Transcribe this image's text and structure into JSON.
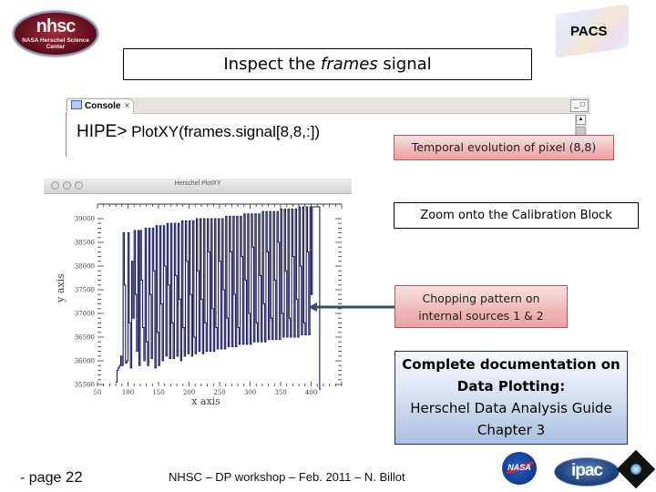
{
  "logos": {
    "nhsc": {
      "main": "nhsc",
      "sub": "NASA Herschel Science Center"
    },
    "pacs": {
      "label": "PACS"
    },
    "nasa": {
      "label": "NASA"
    },
    "ipac": {
      "label": "ipac"
    },
    "herschel": {
      "label": "Herschel"
    }
  },
  "title": {
    "before": "Inspect the ",
    "italic": "frames",
    "after": " signal"
  },
  "console": {
    "tab_label": "Console",
    "tab_close": "×",
    "prompt": "HIPE>",
    "command": " PlotXY(frames.signal[8,8,:])",
    "window_controls": "_ □",
    "scroll_up": "▲"
  },
  "callouts": {
    "temporal": "Temporal evolution of pixel (8,8)",
    "zoom": "Zoom onto the Calibration Block",
    "chopping_line1": "Chopping pattern on",
    "chopping_line2": "internal sources 1 & 2",
    "doc_line1": "Complete documentation on",
    "doc_line2": "Data Plotting:",
    "doc_line3": "Herschel Data Analysis Guide",
    "doc_line4": "Chapter 3"
  },
  "plot_window": {
    "title": "Herschel PlotXY"
  },
  "chart_data": {
    "type": "line",
    "title": "",
    "xlabel": "x axis",
    "ylabel": "y axis",
    "xlim": [
      50,
      450
    ],
    "ylim": [
      35500,
      39000
    ],
    "xticks": [
      50,
      100,
      150,
      200,
      250,
      300,
      350,
      400
    ],
    "yticks": [
      35500,
      36000,
      36500,
      37000,
      37500,
      38000,
      38500,
      39000
    ],
    "grid": false,
    "series": [
      {
        "name": "frames.signal[8,8,:]",
        "color": "#1a1a5e",
        "x": [
          80,
          82,
          84,
          86,
          88,
          90,
          92,
          94,
          96,
          98,
          100,
          102,
          104,
          106,
          108,
          110,
          112,
          114,
          116,
          118,
          120,
          122,
          124,
          126,
          128,
          130,
          132,
          134,
          136,
          138,
          140,
          142,
          144,
          146,
          148,
          150,
          152,
          154,
          156,
          158,
          160,
          162,
          164,
          166,
          168,
          170,
          172,
          174,
          176,
          178,
          180,
          182,
          184,
          186,
          188,
          190,
          192,
          194,
          196,
          198,
          200,
          202,
          204,
          206,
          208,
          210,
          212,
          214,
          216,
          218,
          220,
          222,
          224,
          226,
          228,
          230,
          232,
          234,
          236,
          238,
          240,
          242,
          244,
          246,
          248,
          250,
          252,
          254,
          256,
          258,
          260,
          262,
          264,
          266,
          268,
          270,
          272,
          274,
          276,
          278,
          280,
          282,
          284,
          286,
          288,
          290,
          292,
          294,
          296,
          298,
          300,
          302,
          304,
          306,
          308,
          310,
          312,
          314,
          316,
          318,
          320,
          322,
          324,
          326,
          328,
          330,
          332,
          334,
          336,
          338,
          340,
          342,
          344,
          346,
          348,
          350,
          352,
          354,
          356,
          358,
          360,
          362,
          364,
          366,
          368,
          370,
          372,
          374,
          376,
          378,
          380,
          382,
          384,
          386,
          388,
          390,
          392,
          394,
          396,
          398,
          400,
          402,
          404,
          406,
          408,
          410,
          412,
          414,
          416,
          418,
          420
        ],
        "y": [
          35550,
          35800,
          35850,
          35900,
          36100,
          35900,
          38700,
          37600,
          35950,
          36000,
          38700,
          36800,
          35850,
          38100,
          36900,
          38750,
          37400,
          36200,
          38750,
          35900,
          38750,
          37700,
          36700,
          36000,
          38800,
          36400,
          35900,
          38800,
          37400,
          36050,
          38800,
          37900,
          35850,
          38850,
          36600,
          35900,
          38850,
          37200,
          36000,
          38850,
          38000,
          36100,
          38900,
          37600,
          36050,
          38900,
          36800,
          36050,
          38900,
          37800,
          36100,
          38900,
          37300,
          36000,
          38950,
          36700,
          36100,
          38950,
          38100,
          36150,
          38950,
          37400,
          36100,
          38950,
          36500,
          36150,
          39000,
          37900,
          36200,
          39000,
          37300,
          36150,
          39000,
          36800,
          36200,
          39000,
          38300,
          36200,
          39000,
          37100,
          36200,
          39000,
          36700,
          36250,
          39000,
          38100,
          36250,
          39000,
          37500,
          36250,
          39050,
          36900,
          36300,
          39050,
          38300,
          36300,
          39050,
          37400,
          36300,
          39050,
          36700,
          36350,
          39050,
          38200,
          36350,
          39100,
          37700,
          36350,
          39100,
          37000,
          36350,
          39100,
          38400,
          36400,
          39100,
          36800,
          36400,
          39100,
          37800,
          36400,
          39150,
          37200,
          36400,
          39150,
          38300,
          36450,
          39150,
          36900,
          36450,
          39150,
          37700,
          36450,
          39150,
          38500,
          36450,
          39200,
          37000,
          36500,
          39200,
          37900,
          36500,
          39200,
          36900,
          36500,
          39200,
          38200,
          36500,
          39200,
          37300,
          36500,
          39250,
          38000,
          36550,
          39250,
          36800,
          36550,
          39250,
          38300,
          36550,
          39250,
          37400,
          39250,
          39250,
          39250,
          39250,
          39250,
          39250,
          35400
        ]
      }
    ]
  },
  "footer": {
    "page_prefix": "- page ",
    "page_number": "22",
    "text": "NHSC – DP workshop – Feb. 2011 – N. Billot"
  }
}
